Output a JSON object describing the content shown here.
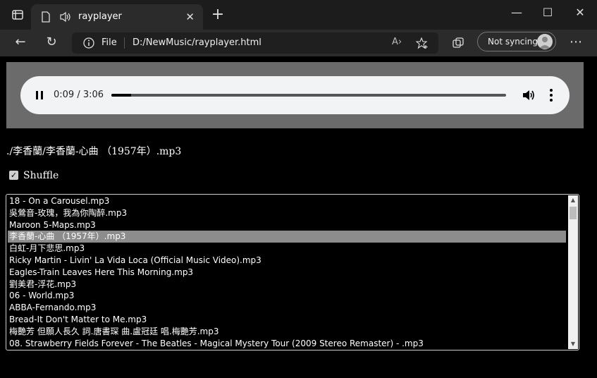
{
  "browser": {
    "tab_title": "rayplayer",
    "address_scheme_label": "File",
    "url": "D:/NewMusic/rayplayer.html",
    "sync_label": "Not syncing"
  },
  "player": {
    "time_display": "0:09 / 3:06",
    "progress_fraction": 0.05
  },
  "now_playing": "./李香蘭/李香蘭-心曲 （1957年）.mp3",
  "shuffle": {
    "label": "Shuffle",
    "checked": true
  },
  "playlist": {
    "selected_index": 3,
    "items": [
      "18 - On a Carousel.mp3",
      "吳鶯音-玫瑰，我為你陶醉.mp3",
      "Maroon 5-Maps.mp3",
      "李香蘭-心曲 （1957年）.mp3",
      "白虹-月下悲思.mp3",
      "Ricky Martin - Livin' La Vida Loca (Official Music Video).mp3",
      "Eagles-Train Leaves Here This Morning.mp3",
      "劉美君-浮花.mp3",
      "06 - World.mp3",
      "ABBA-Fernando.mp3",
      "Bread-It Don't Matter to Me.mp3",
      "梅艷芳 但願人長久 詞.唐書琛 曲.盧冠廷 唱.梅艷芳.mp3",
      "08. Strawberry Fields Forever - The Beatles - Magical Mystery Tour (2009 Stereo Remaster) - .mp3"
    ]
  }
}
